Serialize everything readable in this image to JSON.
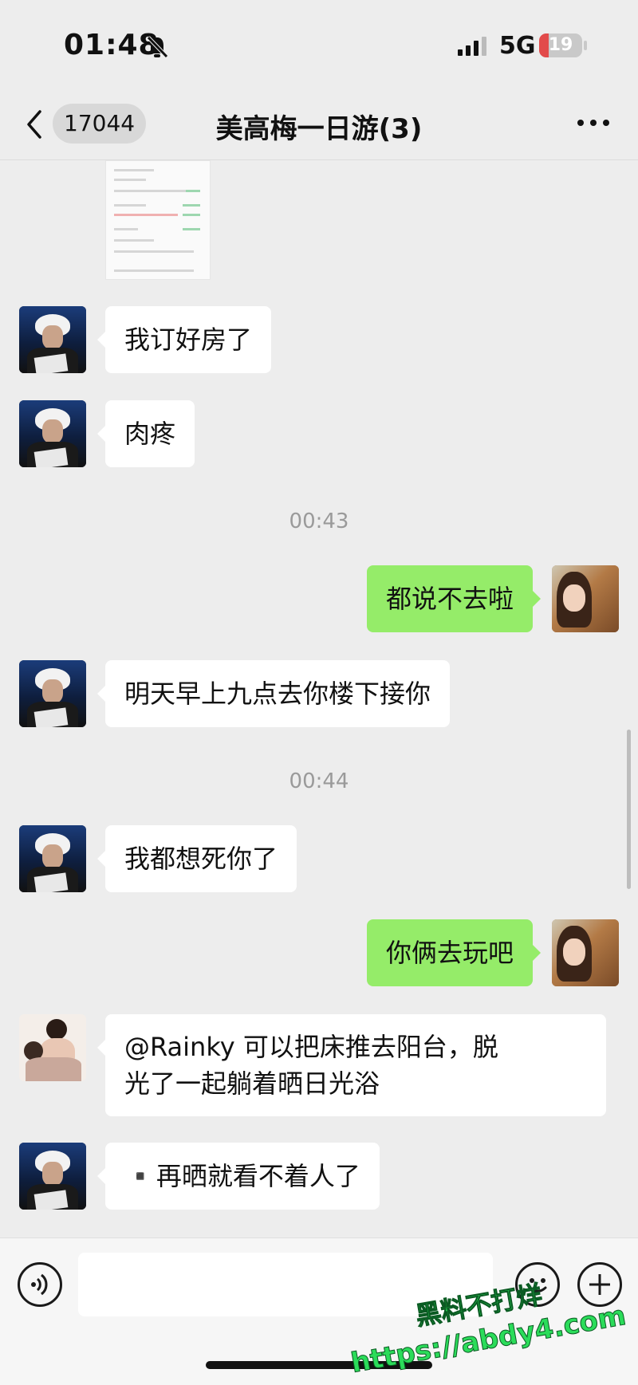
{
  "status_bar": {
    "time": "01:48",
    "network": "5G",
    "battery": "19",
    "bell_icon": "bell-slash-icon",
    "signal_icon": "cellular-signal-icon"
  },
  "nav": {
    "back_icon": "chevron-left-icon",
    "unread_count": "17044",
    "title": "美高梅一日游(3)",
    "more_icon": "more-dots-icon"
  },
  "messages": [
    {
      "type": "image",
      "sender": "friend_a"
    },
    {
      "type": "text",
      "sender": "friend_a",
      "text": "我订好房了"
    },
    {
      "type": "text",
      "sender": "friend_a",
      "text": "肉疼"
    },
    {
      "type": "time",
      "text": "00:43"
    },
    {
      "type": "text",
      "sender": "me",
      "text": "都说不去啦"
    },
    {
      "type": "text",
      "sender": "friend_a",
      "text": "明天早上九点去你楼下接你"
    },
    {
      "type": "time",
      "text": "00:44"
    },
    {
      "type": "text",
      "sender": "friend_a",
      "text": "我都想死你了"
    },
    {
      "type": "text",
      "sender": "me",
      "text": "你俩去玩吧"
    },
    {
      "type": "text",
      "sender": "friend_b",
      "text_line1": "@Rainky 可以把床推去阳台，脱",
      "text_line2": "光了一起躺着晒日光浴"
    },
    {
      "type": "text",
      "sender": "friend_a",
      "text": "▪️再晒就看不着人了"
    }
  ],
  "input_bar": {
    "voice_icon": "voice-icon",
    "emoji_icon": "emoji-icon",
    "plus_icon": "plus-icon"
  },
  "watermark": {
    "line1": "黑料不打烊",
    "line2": "https://abdy4.com"
  }
}
